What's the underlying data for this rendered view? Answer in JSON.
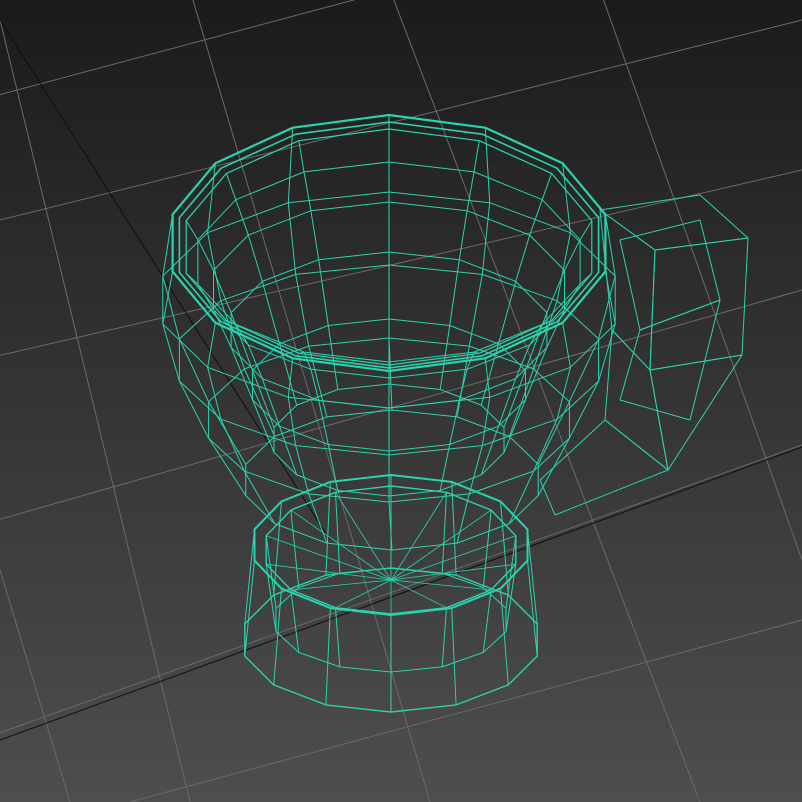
{
  "viewport": {
    "view_type": "perspective",
    "display_mode": "wireframe"
  },
  "scene": {
    "object_name": "",
    "object_type": "mug",
    "wire_color": "#2bd3ad",
    "background_top": "#1b1b1b",
    "background_bottom": "#4e4e4e",
    "grid_color": "#6a6a6a",
    "grid_axis_color": "#0f0f0f"
  }
}
